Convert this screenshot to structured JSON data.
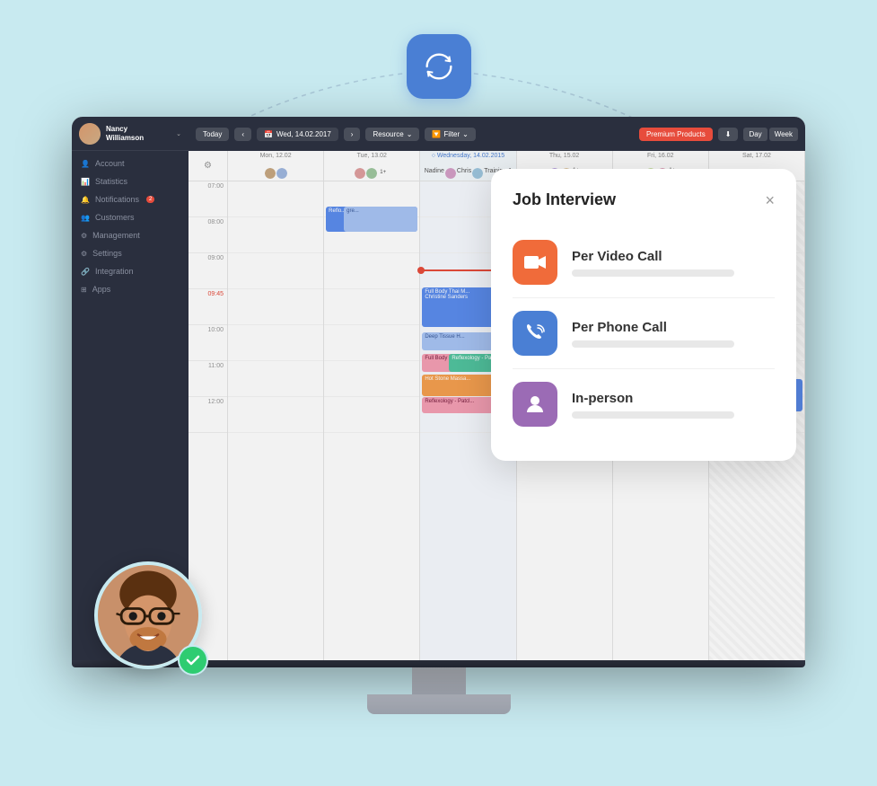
{
  "page": {
    "background_color": "#c8eaf0"
  },
  "sync_icon": {
    "label": "sync-icon",
    "background": "#4a7fd4"
  },
  "sidebar": {
    "user": {
      "name": "Nancy",
      "surname": "Williamson"
    },
    "nav_items": [
      {
        "id": "account",
        "label": "Account",
        "icon": "account-icon"
      },
      {
        "id": "statistics",
        "label": "Statistics",
        "icon": "statistics-icon"
      },
      {
        "id": "notifications",
        "label": "Notifications",
        "icon": "notifications-icon",
        "badge": "2"
      },
      {
        "id": "customers",
        "label": "Customers",
        "icon": "customers-icon"
      },
      {
        "id": "management",
        "label": "Management",
        "icon": "management-icon"
      },
      {
        "id": "settings",
        "label": "Settings",
        "icon": "settings-icon"
      },
      {
        "id": "integration",
        "label": "Integration",
        "icon": "integration-icon"
      },
      {
        "id": "apps",
        "label": "Apps",
        "icon": "apps-icon"
      }
    ]
  },
  "topbar": {
    "today_label": "Today",
    "date_label": "Wed, 14.02.2017",
    "resource_label": "Resource",
    "filter_label": "Filter",
    "premium_label": "Premium Products",
    "day_label": "Day",
    "week_label": "Week"
  },
  "calendar": {
    "days": [
      {
        "name": "Mon, 12.02",
        "today": false
      },
      {
        "name": "Tue, 13.02",
        "today": false
      },
      {
        "name": "Wednesday, 14.02.2015",
        "today": true
      },
      {
        "name": "Thu, 15.02",
        "today": false
      },
      {
        "name": "Fri, 16.02",
        "today": false
      },
      {
        "name": "Sat, 17.02",
        "today": false
      }
    ],
    "times": [
      "07:00",
      "08:00",
      "09:00",
      "09:45",
      "10:00",
      "11:00",
      "12:00"
    ],
    "events": [
      {
        "label": "Full Body Thai M...",
        "sublabel": "Christine Sanders",
        "color": "blue"
      },
      {
        "label": "Deep Tissue H...",
        "color": "light-blue"
      },
      {
        "label": "Full Body Th...",
        "color": "light-blue"
      },
      {
        "label": "Reflexology - Patcl...",
        "color": "pink"
      },
      {
        "label": "Hot Stone Massa...",
        "color": "green"
      },
      {
        "label": "Reflexology - Patcl...",
        "color": "orange"
      },
      {
        "label": "Reflo...",
        "color": "blue"
      }
    ]
  },
  "modal": {
    "title": "Job Interview",
    "close_label": "×",
    "options": [
      {
        "id": "video-call",
        "icon": "video-camera-icon",
        "icon_color": "#f06b3a",
        "title": "Per Video Call"
      },
      {
        "id": "phone-call",
        "icon": "phone-icon",
        "icon_color": "#4a7fd4",
        "title": "Per Phone Call"
      },
      {
        "id": "in-person",
        "icon": "person-icon",
        "icon_color": "#9b6bb5",
        "title": "In-person"
      }
    ]
  },
  "person": {
    "label": "Person with glasses",
    "checkmark_color": "#2ecc71"
  }
}
